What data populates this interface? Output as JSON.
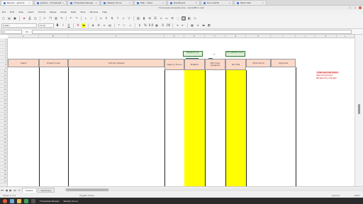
{
  "browser": {
    "tabs": [
      {
        "label": "Banner - Jenkins"
      },
      {
        "label": "Jenkins - Timesheet"
      },
      {
        "label": "Timesheet Review"
      },
      {
        "label": "Weekly Hours"
      },
      {
        "label": "Mail - Inbox"
      },
      {
        "label": "Dashboard"
      },
      {
        "label": "Documents"
      },
      {
        "label": "Team Site"
      }
    ]
  },
  "window": {
    "title": "Timesheet_template.xlsx - LibreOffice Calc"
  },
  "menubar": {
    "items": [
      "File",
      "Edit",
      "View",
      "Insert",
      "Format",
      "Styles",
      "Sheet",
      "Data",
      "Tools",
      "Window",
      "Help"
    ]
  },
  "toolbar": {
    "font_name": "Calibri",
    "font_size": "10 pt"
  },
  "formula": {
    "cell_ref": "A1",
    "fx": "fx",
    "value": ""
  },
  "grid": {
    "columns": [
      "A",
      "B",
      "C",
      "D",
      "E",
      "F",
      "G",
      "H",
      "I",
      "J",
      "K",
      "L"
    ],
    "rows": [
      "1",
      "2",
      "3",
      "4",
      "5",
      "6",
      "7",
      "8",
      "9",
      "10",
      "11",
      "12",
      "13",
      "14",
      "15",
      "16",
      "17",
      "18",
      "19",
      "20",
      "21",
      "22",
      "23",
      "24",
      "25",
      "26",
      "27",
      "28",
      "29",
      "30",
      "31",
      "32",
      "33",
      "34",
      "35",
      "36",
      "37",
      "38",
      "39",
      "40",
      "41"
    ],
    "headers": {
      "a": "Client",
      "b": "Project Code",
      "c": "Activity Details",
      "d": "Work Notes",
      "e": "Agency Hours",
      "f": "Billable",
      "g": "Bill Code Assigned",
      "h": "Non Bill",
      "i": "Total Hours",
      "j": "Approval"
    },
    "green_boxes": [
      "Billable Hours",
      "Non Billable Hours"
    ],
    "arrow_label": "→",
    "side_notes": [
      "Total over limit check",
      "Approval pending",
      "Reviewed by manager"
    ]
  },
  "sheets": [
    {
      "label": "Sheet1"
    },
    {
      "label": "Summary"
    }
  ],
  "sheetbar_extra": {
    "buttons": [
      "Sheet nav",
      "Add Sheet"
    ]
  },
  "status": {
    "left": "Sheet 1 of 2",
    "middle": "English (USA)",
    "right": "Sum=0",
    "zoom": "100%"
  },
  "taskbar": {
    "apps": [
      "Files",
      "Browser",
      "Calc",
      "Terminal"
    ],
    "items": [
      "Timesheet Review",
      "Weekly Hours"
    ]
  },
  "colors": {
    "header_fill": "#fbd9c9",
    "highlight": "#ffff00",
    "note_red": "#cc0000"
  }
}
